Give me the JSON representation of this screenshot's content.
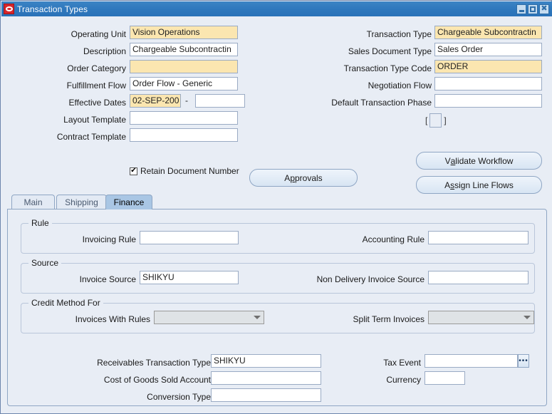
{
  "window": {
    "title": "Transaction Types",
    "logo_icon": "oracle-logo-icon",
    "minimize_icon": "minimize-icon",
    "maximize_icon": "maximize-icon",
    "close_icon": "close-icon",
    "close_glyph": "✖"
  },
  "header": {
    "left_fields": [
      {
        "label": "Operating Unit",
        "value": "Vision Operations",
        "style": "required"
      },
      {
        "label": "Description",
        "value": "Chargeable Subcontractin",
        "style": "normal"
      },
      {
        "label": "Order Category",
        "value": "",
        "style": "required"
      },
      {
        "label": "Fulfillment Flow",
        "value": "Order Flow - Generic",
        "style": "normal"
      },
      {
        "label": "Effective Dates",
        "value": "02-SEP-200",
        "style": "selected"
      },
      {
        "label": "Layout Template",
        "value": "",
        "style": "normal"
      },
      {
        "label": "Contract Template",
        "value": "",
        "style": "normal"
      }
    ],
    "effective_dates_separator": "-",
    "effective_dates_to": "",
    "right_fields": [
      {
        "label": "Transaction Type",
        "value": "Chargeable Subcontractin",
        "style": "required"
      },
      {
        "label": "Sales Document Type",
        "value": "Sales Order",
        "style": "normal"
      },
      {
        "label": "Transaction Type Code",
        "value": "ORDER",
        "style": "required"
      },
      {
        "label": "Negotiation Flow",
        "value": "",
        "style": "normal"
      },
      {
        "label": "Default Transaction Phase",
        "value": "",
        "style": "normal"
      }
    ],
    "flexfield": {
      "open": "[",
      "close": "]",
      "value": ""
    },
    "checkbox": {
      "label": "Retain Document Number",
      "checked": true,
      "glyph": "✔"
    },
    "buttons": {
      "approvals": {
        "pre": "A",
        "mnemonic": "p",
        "post": "provals"
      },
      "validate_workflow": {
        "pre": "V",
        "mnemonic": "a",
        "post": "lidate Workflow"
      },
      "assign_line_flows": {
        "pre": "A",
        "mnemonic": "s",
        "post": "sign Line  Flows"
      }
    }
  },
  "tabs": [
    {
      "label": "Main",
      "active": false
    },
    {
      "label": "Shipping",
      "active": false
    },
    {
      "label": "Finance",
      "active": true
    }
  ],
  "finance": {
    "rule_group": {
      "title": "Rule"
    },
    "source_group": {
      "title": "Source"
    },
    "credit_group": {
      "title": "Credit Method For"
    },
    "fields": {
      "invoicing_rule": {
        "label": "Invoicing Rule",
        "value": ""
      },
      "accounting_rule": {
        "label": "Accounting Rule",
        "value": ""
      },
      "invoice_source": {
        "label": "Invoice Source",
        "value": "SHIKYU"
      },
      "non_delivery_invoice_source": {
        "label": "Non Delivery Invoice Source",
        "value": ""
      },
      "invoices_with_rules": {
        "label": "Invoices With Rules",
        "value": ""
      },
      "split_term_invoices": {
        "label": "Split Term Invoices",
        "value": ""
      },
      "receivables_transaction_type": {
        "label": "Receivables Transaction Type",
        "value": "SHIKYU"
      },
      "cost_of_goods_sold_account": {
        "label": "Cost of Goods Sold Account",
        "value": ""
      },
      "conversion_type": {
        "label": "Conversion Type",
        "value": ""
      },
      "tax_event": {
        "label": "Tax Event",
        "value": ""
      },
      "currency": {
        "label": "Currency",
        "value": ""
      }
    },
    "lov_button_glyph": "•••"
  }
}
